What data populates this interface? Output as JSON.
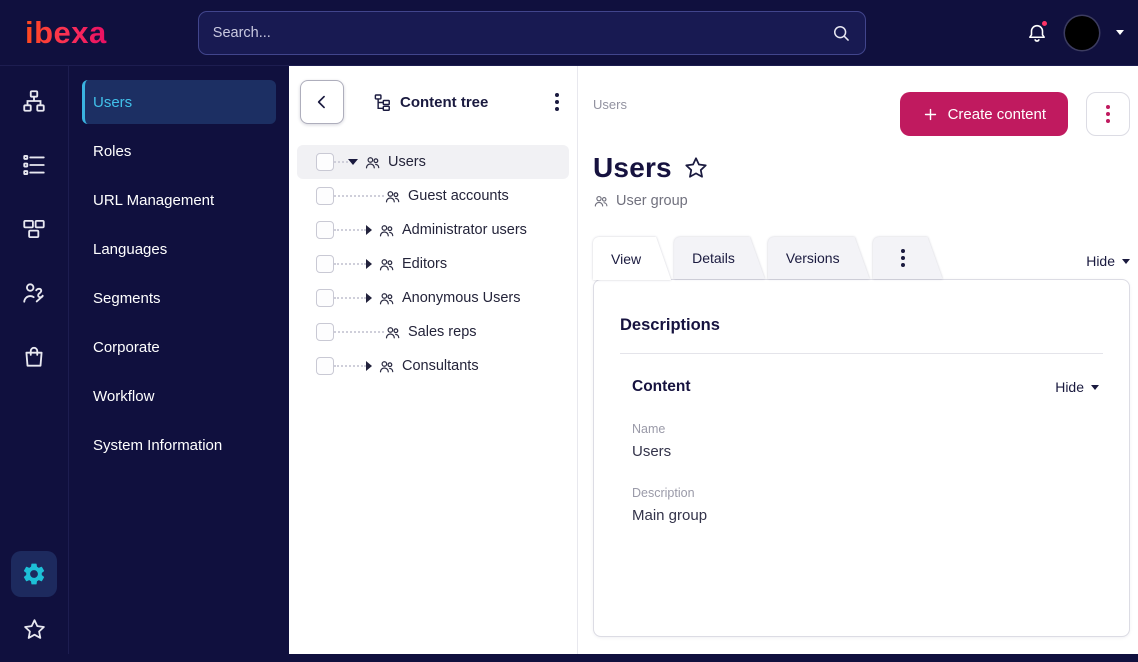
{
  "topbar": {
    "logo_text": "ibexa",
    "search": {
      "placeholder": "Search..."
    }
  },
  "icon_rail": {
    "top_icons": [
      "sitemap",
      "content-list",
      "modules",
      "personalization",
      "commerce"
    ],
    "bottom_icons": [
      "settings-gear",
      "bookmarks-star"
    ],
    "active_icon": "settings-gear"
  },
  "sidebar": {
    "items": [
      {
        "label": "Users",
        "active": true
      },
      {
        "label": "Roles",
        "active": false
      },
      {
        "label": "URL Management",
        "active": false
      },
      {
        "label": "Languages",
        "active": false
      },
      {
        "label": "Segments",
        "active": false
      },
      {
        "label": "Corporate",
        "active": false
      },
      {
        "label": "Workflow",
        "active": false
      },
      {
        "label": "System Information",
        "active": false
      }
    ]
  },
  "content_tree": {
    "title": "Content tree",
    "rows": [
      {
        "label": "Users",
        "level": 0,
        "expanded": true,
        "selected": true,
        "has_children": true
      },
      {
        "label": "Guest accounts",
        "level": 1,
        "has_children": false
      },
      {
        "label": "Administrator users",
        "level": 1,
        "has_children": true
      },
      {
        "label": "Editors",
        "level": 1,
        "has_children": true
      },
      {
        "label": "Anonymous Users",
        "level": 1,
        "has_children": true
      },
      {
        "label": "Sales reps",
        "level": 1,
        "has_children": false
      },
      {
        "label": "Consultants",
        "level": 1,
        "has_children": true
      }
    ]
  },
  "main": {
    "breadcrumb": "Users",
    "create_button_label": "Create content",
    "page_title": "Users",
    "content_type": "User group",
    "tabs": [
      {
        "label": "View",
        "active": true
      },
      {
        "label": "Details",
        "active": false
      },
      {
        "label": "Versions",
        "active": false
      }
    ],
    "hide_toggle": "Hide",
    "card": {
      "heading": "Descriptions",
      "section": {
        "title": "Content",
        "hide_toggle": "Hide",
        "fields": [
          {
            "label": "Name",
            "value": "Users"
          },
          {
            "label": "Description",
            "value": "Main group"
          }
        ]
      }
    }
  },
  "colors": {
    "navy": "#10103e",
    "accent_teal": "#1ec9de",
    "active_item_text": "#41c1ea",
    "primary_pink": "#c01a5f",
    "text_dark": "#1a1a3f",
    "text_muted": "#9292a0"
  }
}
